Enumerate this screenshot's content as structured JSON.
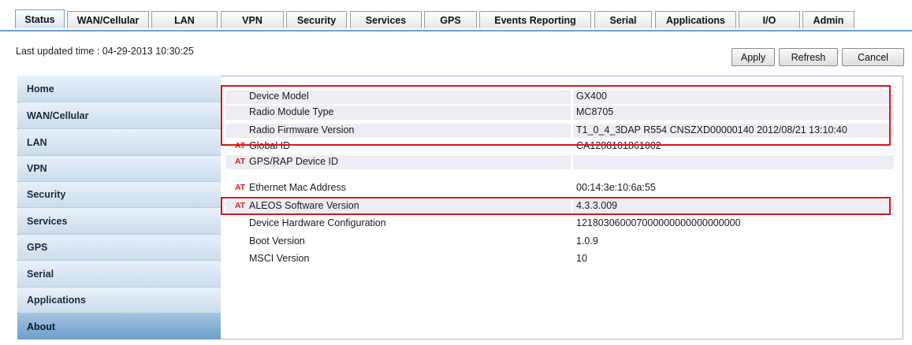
{
  "tabs": [
    {
      "label": "Status",
      "active": true
    },
    {
      "label": "WAN/Cellular"
    },
    {
      "label": "LAN"
    },
    {
      "label": "VPN"
    },
    {
      "label": "Security"
    },
    {
      "label": "Services"
    },
    {
      "label": "GPS"
    },
    {
      "label": "Events Reporting"
    },
    {
      "label": "Serial"
    },
    {
      "label": "Applications"
    },
    {
      "label": "I/O"
    },
    {
      "label": "Admin"
    }
  ],
  "last_updated": "Last updated time : 04-29-2013 10:30:25",
  "buttons": {
    "apply": "Apply",
    "refresh": "Refresh",
    "cancel": "Cancel"
  },
  "sidebar": [
    {
      "label": "Home"
    },
    {
      "label": "WAN/Cellular"
    },
    {
      "label": "LAN"
    },
    {
      "label": "VPN"
    },
    {
      "label": "Security"
    },
    {
      "label": "Services"
    },
    {
      "label": "GPS"
    },
    {
      "label": "Serial"
    },
    {
      "label": "Applications"
    },
    {
      "label": "About",
      "active": true
    }
  ],
  "at_marker": "AT",
  "rows": [
    {
      "label": "Device Model",
      "value": "GX400",
      "at": false
    },
    {
      "label": "Radio Module Type",
      "value": "MC8705",
      "at": false
    },
    {
      "label": "Radio Firmware Version",
      "value": "T1_0_4_3DAP R554 CNSZXD00000140 2012/08/21 13:10:40",
      "at": false
    },
    {
      "label": "Global ID",
      "value": "CA1288101861002",
      "at": true
    },
    {
      "label": "GPS/RAP Device ID",
      "value": "",
      "at": true
    },
    {
      "label": "Ethernet Mac Address",
      "value": "00:14:3e:10:6a:55",
      "at": true
    },
    {
      "label": "ALEOS Software Version",
      "value": "4.3.3.009",
      "at": true
    },
    {
      "label": "Device Hardware Configuration",
      "value": "121803060007000000000000000000",
      "at": false
    },
    {
      "label": "Boot Version",
      "value": "1.0.9",
      "at": false
    },
    {
      "label": "MSCI Version",
      "value": "10",
      "at": false
    }
  ],
  "colors": {
    "highlight": "#d9141b",
    "at_marker": "#d81e1e",
    "accent": "#6f9ed1"
  }
}
